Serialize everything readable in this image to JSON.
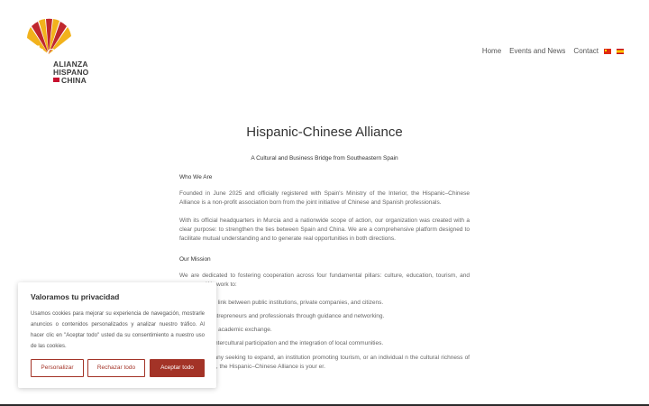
{
  "logo": {
    "mark": "ahc",
    "line1": "ALIANZA",
    "line2": "HISPANO",
    "line3": "CHINA",
    "colors": {
      "red": "#c0272d",
      "yellow": "#f2b21c"
    }
  },
  "nav": {
    "items": [
      {
        "label": "Home"
      },
      {
        "label": "Events and News"
      },
      {
        "label": "Contact"
      }
    ],
    "languages": [
      "chinese-flag-icon",
      "spain-flag-icon"
    ]
  },
  "main": {
    "title": "Hispanic-Chinese Alliance",
    "subtitle": "A Cultural and Business Bridge from Southeastern Spain",
    "who_heading": "Who We Are",
    "para1": "Founded in June 2025 and officially registered with Spain's Ministry of the Interior, the Hispanic–Chinese Alliance is a non-profit association born from the joint initiative of Chinese and Spanish professionals.",
    "para2": "With its official headquarters in Murcia and a nationwide scope of action, our organization was created with a clear purpose: to strengthen the ties between Spain and China. We are a comprehensive platform designed to facilitate mutual understanding and to generate real opportunities in both directions.",
    "mission_heading": "Our Mission",
    "mission_intro": "We are dedicated to fostering cooperation across four fundamental pillars: culture, education, tourism, and economy. We work to:",
    "pillars": [
      {
        "key": "ct:",
        "text": " Serve as a link between public institutions, private companies, and citizens."
      },
      {
        "key": "te:",
        "text": " Support entrepreneurs and professionals through guidance and networking."
      },
      {
        "key": "te:",
        "text": " Encourage academic exchange."
      },
      {
        "key": "te:",
        "text": " Facilitate intercultural participation and the integration of local communities."
      }
    ],
    "closing": "s are a company seeking to expand, an institution promoting tourism, or an individual n the cultural richness of both countries, the Hispanic–Chinese Alliance is your er."
  },
  "cookie": {
    "title": "Valoramos tu privacidad",
    "text": "Usamos cookies para mejorar su experiencia de navegación, mostrarle anuncios o contenidos personalizados y analizar nuestro tráfico. Al hacer clic en \"Aceptar todo\" usted da su consentimiento a nuestro uso de las cookies.",
    "customize": "Personalizar",
    "reject": "Rechazar todo",
    "accept": "Aceptar todo",
    "accent": "#a33327"
  }
}
